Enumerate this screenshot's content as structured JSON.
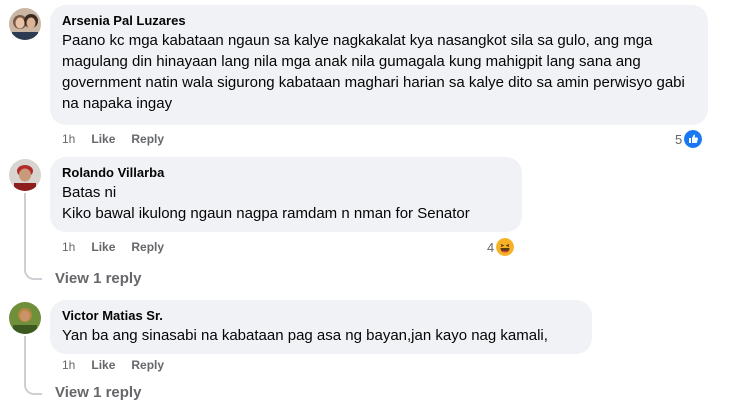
{
  "comments": [
    {
      "author": "Arsenia Pal Luzares",
      "text": "Paano kc mga kabataan ngaun sa kalye nagkakalat kya nasangkot sila sa gulo, ang mga magulang din hinayaan lang nila mga anak nila gumagala kung mahigpit lang sana ang government natin wala sigurong kabataan maghari harian sa kalye dito sa amin perwisyo gabi na napaka ingay",
      "time": "1h",
      "like_label": "Like",
      "reply_label": "Reply",
      "reaction_count": "5",
      "reaction_icon": "like-icon",
      "reaction_color": "#1877f2"
    },
    {
      "author": "Rolando Villarba",
      "text": "Batas ni\nKiko bawal ikulong ngaun nagpa ramdam n nman for Senator",
      "time": "1h",
      "like_label": "Like",
      "reply_label": "Reply",
      "reaction_count": "4",
      "reaction_icon": "haha-icon",
      "reaction_color": "#f7b125",
      "view_replies": "View 1 reply"
    },
    {
      "author": "Victor Matias Sr.",
      "text": "Yan ba ang sinasabi na kabataan pag asa ng bayan,jan kayo nag kamali,",
      "time": "1h",
      "like_label": "Like",
      "reply_label": "Reply",
      "view_replies": "View 1 reply"
    }
  ],
  "colors": {
    "bubble": "#f0f2f5",
    "secondary_text": "#65676b",
    "like_blue": "#1877f2"
  }
}
